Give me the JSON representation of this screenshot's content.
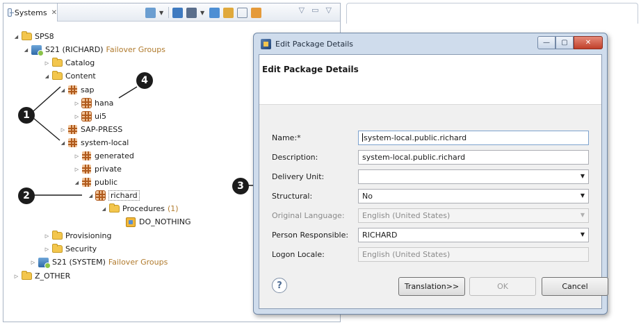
{
  "systems_view": {
    "tab_label": "Systems",
    "tab_close": "✕",
    "view_menu": [
      "▽",
      "▭",
      "▽"
    ]
  },
  "tree": {
    "nodes": [
      {
        "label": "SPS8",
        "twisty": "◢"
      },
      {
        "label": "S21 (RICHARD)",
        "suffix": "Failover Groups",
        "twisty": "◢"
      },
      {
        "label": "Catalog",
        "twisty": "▷"
      },
      {
        "label": "Content",
        "twisty": "◢"
      },
      {
        "label": "sap",
        "twisty": "◢"
      },
      {
        "label": "hana",
        "twisty": "▷"
      },
      {
        "label": "ui5",
        "twisty": "▷"
      },
      {
        "label": "SAP-PRESS",
        "twisty": "▷"
      },
      {
        "label": "system-local",
        "twisty": "◢"
      },
      {
        "label": "generated",
        "twisty": "▷"
      },
      {
        "label": "private",
        "twisty": "▷"
      },
      {
        "label": "public",
        "twisty": "◢"
      },
      {
        "label": "richard",
        "twisty": "◢"
      },
      {
        "label": "Procedures",
        "suffix": "(1)",
        "twisty": "◢"
      },
      {
        "label": "DO_NOTHING"
      },
      {
        "label": "Provisioning",
        "twisty": "▷"
      },
      {
        "label": "Security",
        "twisty": "▷"
      },
      {
        "label": "S21 (SYSTEM)",
        "suffix": "Failover Groups",
        "twisty": "▷"
      },
      {
        "label": "Z_OTHER",
        "twisty": "▷"
      }
    ]
  },
  "callouts": [
    "1",
    "2",
    "3",
    "4"
  ],
  "dialog": {
    "window_title": "Edit Package Details",
    "banner_title": "Edit Package Details",
    "window_buttons": {
      "minimize": "—",
      "maximize": "▢",
      "close": "✕"
    },
    "fields": {
      "name": {
        "label": "Name:*",
        "value": "system-local.public.richard"
      },
      "description": {
        "label": "Description:",
        "value": "system-local.public.richard"
      },
      "delivery_unit": {
        "label": "Delivery Unit:",
        "value": ""
      },
      "structural": {
        "label": "Structural:",
        "value": "No"
      },
      "original_language": {
        "label": "Original Language:",
        "value": "English (United States)"
      },
      "person_responsible": {
        "label": "Person Responsible:",
        "value": "RICHARD"
      },
      "logon_locale": {
        "label": "Logon Locale:",
        "value": "English (United States)"
      }
    },
    "help": "?",
    "buttons": {
      "translation": "Translation>>",
      "ok": "OK",
      "cancel": "Cancel"
    }
  },
  "icons": [
    "systems-view-icon",
    "folder-icon",
    "system-icon",
    "package-icon",
    "procedure-icon",
    "help-icon",
    "app-icon"
  ],
  "colors": {
    "failover_text": "#b07a2c",
    "callout": "#1c1c1c",
    "dialog_frame": "#cfdcec"
  }
}
